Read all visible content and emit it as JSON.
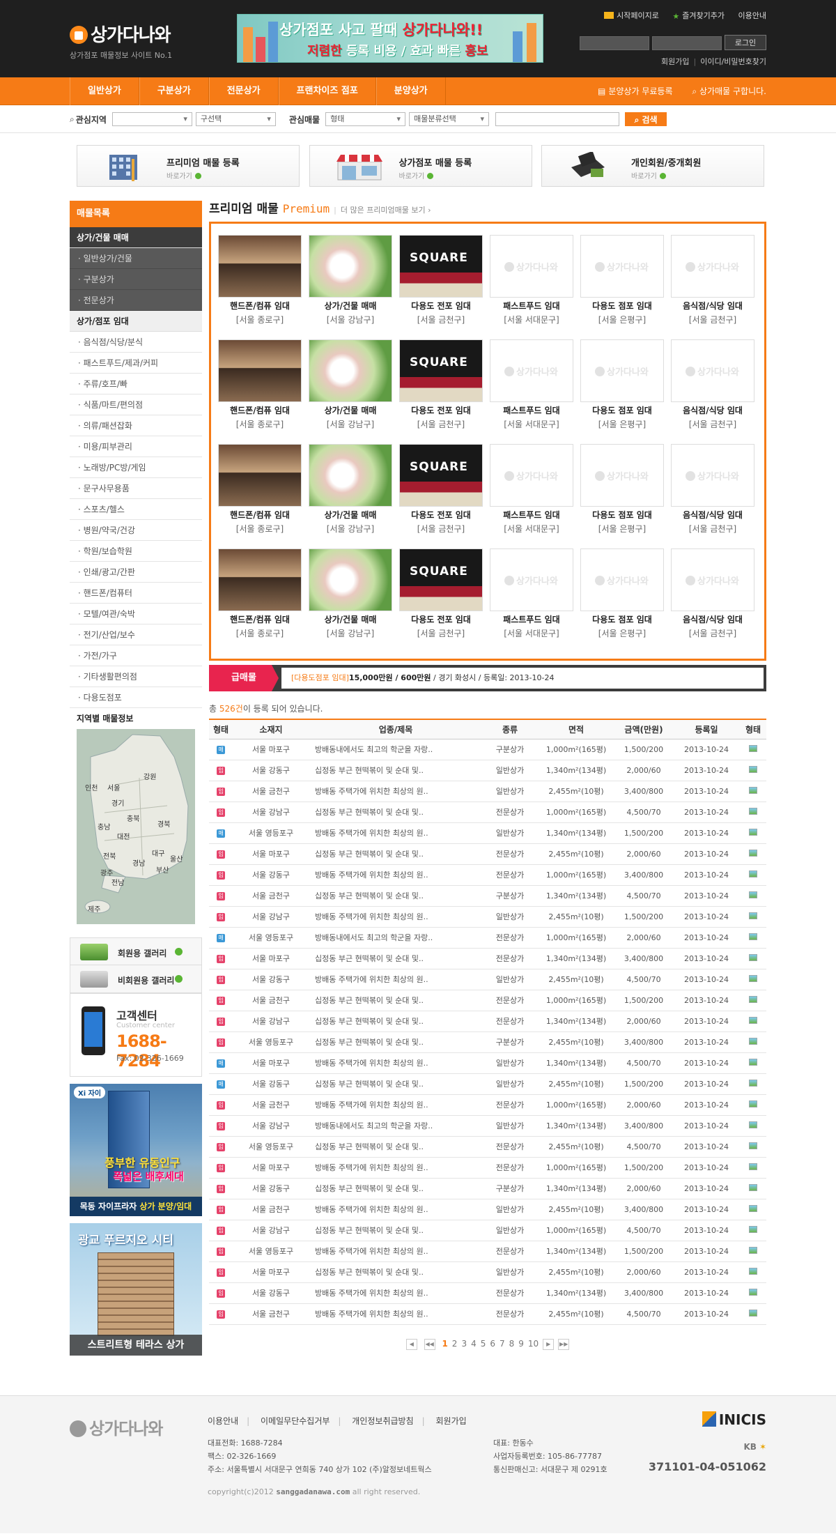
{
  "header": {
    "logo_text": "상가다나와",
    "logo_sub": "상가점포 매물정보 사이트 No.1",
    "banner_line1_a": "상가점포 사고 팔때 ",
    "banner_line1_b": "상가다나와!!",
    "banner_line2_a": "저렴한",
    "banner_line2_b": " 등록 비용 / 효과 빠른 ",
    "banner_line2_c": "홍보",
    "top_links": [
      "시작페이지로",
      "즐겨찾기추가",
      "이용안내"
    ],
    "login_button": "로그인",
    "join": "회원가입",
    "find_id": "이이디/비밀번호찾기"
  },
  "nav": {
    "menu": [
      "일반상가",
      "구분상가",
      "전문상가",
      "프랜차이즈 점포",
      "분양상가"
    ],
    "free_register": "분양상가 무료등록",
    "looking": "상가매물 구합니다."
  },
  "search": {
    "region_label": "관심지역",
    "district_select": "구선택",
    "property_label": "관심매물",
    "type_select": "형태",
    "category_select": "매물분류선택",
    "button": "검색"
  },
  "quick": [
    {
      "title": "프리미엄 매물 등록",
      "sub": "바로가기"
    },
    {
      "title": "상가점포 매물 등록",
      "sub": "바로가기"
    },
    {
      "title": "개인회원/중개회원",
      "sub": "바로가기"
    }
  ],
  "sidebar": {
    "head": "매물목록",
    "sec1": "상가/건물 매매",
    "sec1_items": [
      "· 일반상가/건물",
      "· 구분상가",
      "· 전문상가"
    ],
    "sec2": "상가/점포 임대",
    "sec2_items": [
      "· 음식점/식당/분식",
      "· 패스트푸드/제과/커피",
      "· 주류/호프/빠",
      "· 식품/마트/편의점",
      "· 의류/패션잡화",
      "· 미용/피부관리",
      "· 노래방/PC방/게임",
      "· 문구사무용품",
      "· 스포츠/헬스",
      "· 병원/약국/건강",
      "· 학원/보습학원",
      "· 인쇄/광고/간판",
      "· 핸드폰/컴퓨터",
      "· 모텔/여관/숙박",
      "· 전기/산업/보수",
      "· 가전/가구",
      "· 기타생활편의점",
      "· 다용도점포"
    ],
    "map_title": "지역별 매물정보",
    "regions": [
      "강원",
      "인천",
      "서울",
      "경기",
      "충북",
      "충남",
      "대전",
      "경북",
      "전북",
      "대구",
      "울산",
      "경남",
      "부산",
      "광주",
      "전남",
      "제주"
    ],
    "gallery1": "회원용 갤러리",
    "gallery2": "비회원용 갤러리",
    "cs_title": "고객센터",
    "cs_en": "Customer center",
    "cs_phone": "1688-7284",
    "cs_fax": "Fax: 02-326-1669",
    "ad1_badge": "Xi 자이",
    "ad1_l1": "풍부한 유동인구",
    "ad1_l2": "폭넓은 배후세대",
    "ad1_bar_a": "목동 자이프라자 ",
    "ad1_bar_b": "상가 분양/임대",
    "ad2_title": "광교 푸르지오 시티",
    "ad2_bar": "스트리트형 테라스 상가"
  },
  "premium": {
    "title": "프리미엄 매물 ",
    "title_en": "Premium",
    "more": "더 많은 프리미엄매물 보기 ›",
    "img_square": "SQUARE",
    "placeholder": "상가다나와",
    "items": [
      {
        "name": "핸드폰/컴퓨 임대",
        "loc": "[서울 종로구]",
        "img": "r1"
      },
      {
        "name": "상가/건물 매매",
        "loc": "[서울 강남구]",
        "img": "r2"
      },
      {
        "name": "다용도 전포 임대",
        "loc": "[서울 금천구]",
        "img": "r3"
      },
      {
        "name": "패스트푸드 임대",
        "loc": "[서울 서대문구]",
        "img": "ph"
      },
      {
        "name": "다용도 점포 임대",
        "loc": "[서울 은평구]",
        "img": "ph"
      },
      {
        "name": "음식점/식당 임대",
        "loc": "[서울 금천구]",
        "img": "ph"
      }
    ]
  },
  "urgent": {
    "label": "급매물",
    "cat": "[다용도점포 임대]",
    "price": "15,000만원 / 600만원",
    "rest": " / 경기 화성시 / 등록일: 2013-10-24"
  },
  "list": {
    "total_a": "총 ",
    "total_b": "526건",
    "total_c": "이 등록 되어 있습니다.",
    "headers": [
      "형태",
      "소재지",
      "업종/제목",
      "종류",
      "면적",
      "금액(만원)",
      "등록일",
      "형태"
    ],
    "rows": [
      {
        "t": "m",
        "loc": "서울 마포구",
        "title": "방배동내에서도 최고의 학군을 자랑..",
        "kind": "구분상가",
        "area": "1,000m²(165평)",
        "price": "1,500/200",
        "date": "2013-10-24"
      },
      {
        "t": "i",
        "loc": "서울 강동구",
        "title": "십정동 부근 현떡볶이 및 순대 및..",
        "kind": "일반상가",
        "area": "1,340m²(134평)",
        "price": "2,000/60",
        "date": "2013-10-24"
      },
      {
        "t": "i",
        "loc": "서울 금천구",
        "title": "방배동 주택가에 위치한 최상의 원..",
        "kind": "일반상가",
        "area": "2,455m²(10평)",
        "price": "3,400/800",
        "date": "2013-10-24"
      },
      {
        "t": "i",
        "loc": "서울 강남구",
        "title": "십정동 부근 현떡볶이 및 순대 및..",
        "kind": "전문상가",
        "area": "1,000m²(165평)",
        "price": "4,500/70",
        "date": "2013-10-24"
      },
      {
        "t": "m",
        "loc": "서울 영등포구",
        "title": "방배동 주택가에 위치한 최상의 원..",
        "kind": "일반상가",
        "area": "1,340m²(134평)",
        "price": "1,500/200",
        "date": "2013-10-24"
      },
      {
        "t": "i",
        "loc": "서울 마포구",
        "title": "십정동 부근 현떡볶이 및 순대 및..",
        "kind": "전문상가",
        "area": "2,455m²(10평)",
        "price": "2,000/60",
        "date": "2013-10-24"
      },
      {
        "t": "i",
        "loc": "서울 강동구",
        "title": "방배동 주택가에 위치한 최상의 원..",
        "kind": "전문상가",
        "area": "1,000m²(165평)",
        "price": "3,400/800",
        "date": "2013-10-24"
      },
      {
        "t": "i",
        "loc": "서울 금천구",
        "title": "십정동 부근 현떡볶이 및 순대 및..",
        "kind": "구분상가",
        "area": "1,340m²(134평)",
        "price": "4,500/70",
        "date": "2013-10-24"
      },
      {
        "t": "i",
        "loc": "서울 강남구",
        "title": "방배동 주택가에 위치한 최상의 원..",
        "kind": "일반상가",
        "area": "2,455m²(10평)",
        "price": "1,500/200",
        "date": "2013-10-24"
      },
      {
        "t": "m",
        "loc": "서울 영등포구",
        "title": "방배동내에서도 최고의 학군을 자랑..",
        "kind": "전문상가",
        "area": "1,000m²(165평)",
        "price": "2,000/60",
        "date": "2013-10-24"
      },
      {
        "t": "i",
        "loc": "서울 마포구",
        "title": "십정동 부근 현떡볶이 및 순대 및..",
        "kind": "전문상가",
        "area": "1,340m²(134평)",
        "price": "3,400/800",
        "date": "2013-10-24"
      },
      {
        "t": "i",
        "loc": "서울 강동구",
        "title": "방배동 주택가에 위치한 최상의 원..",
        "kind": "일반상가",
        "area": "2,455m²(10평)",
        "price": "4,500/70",
        "date": "2013-10-24"
      },
      {
        "t": "i",
        "loc": "서울 금천구",
        "title": "십정동 부근 현떡볶이 및 순대 및..",
        "kind": "전문상가",
        "area": "1,000m²(165평)",
        "price": "1,500/200",
        "date": "2013-10-24"
      },
      {
        "t": "i",
        "loc": "서울 강남구",
        "title": "십정동 부근 현떡볶이 및 순대 및..",
        "kind": "전문상가",
        "area": "1,340m²(134평)",
        "price": "2,000/60",
        "date": "2013-10-24"
      },
      {
        "t": "i",
        "loc": "서울 영등포구",
        "title": "십정동 부근 현떡볶이 및 순대 및..",
        "kind": "구분상가",
        "area": "2,455m²(10평)",
        "price": "3,400/800",
        "date": "2013-10-24"
      },
      {
        "t": "m",
        "loc": "서울 마포구",
        "title": "방배동 주택가에 위치한 최상의 원..",
        "kind": "일반상가",
        "area": "1,340m²(134평)",
        "price": "4,500/70",
        "date": "2013-10-24"
      },
      {
        "t": "m",
        "loc": "서울 강동구",
        "title": "십정동 부근 현떡볶이 및 순대 및..",
        "kind": "일반상가",
        "area": "2,455m²(10평)",
        "price": "1,500/200",
        "date": "2013-10-24"
      },
      {
        "t": "i",
        "loc": "서울 금천구",
        "title": "방배동 주택가에 위치한 최상의 원..",
        "kind": "전문상가",
        "area": "1,000m²(165평)",
        "price": "2,000/60",
        "date": "2013-10-24"
      },
      {
        "t": "i",
        "loc": "서울 강남구",
        "title": "방배동내에서도 최고의 학군을 자랑..",
        "kind": "일반상가",
        "area": "1,340m²(134평)",
        "price": "3,400/800",
        "date": "2013-10-24"
      },
      {
        "t": "i",
        "loc": "서울 영등포구",
        "title": "십정동 부근 현떡볶이 및 순대 및..",
        "kind": "전문상가",
        "area": "2,455m²(10평)",
        "price": "4,500/70",
        "date": "2013-10-24"
      },
      {
        "t": "i",
        "loc": "서울 마포구",
        "title": "방배동 주택가에 위치한 최상의 원..",
        "kind": "전문상가",
        "area": "1,000m²(165평)",
        "price": "1,500/200",
        "date": "2013-10-24"
      },
      {
        "t": "i",
        "loc": "서울 강동구",
        "title": "십정동 부근 현떡볶이 및 순대 및..",
        "kind": "구분상가",
        "area": "1,340m²(134평)",
        "price": "2,000/60",
        "date": "2013-10-24"
      },
      {
        "t": "i",
        "loc": "서울 금천구",
        "title": "방배동 주택가에 위치한 최상의 원..",
        "kind": "일반상가",
        "area": "2,455m²(10평)",
        "price": "3,400/800",
        "date": "2013-10-24"
      },
      {
        "t": "i",
        "loc": "서울 강남구",
        "title": "십정동 부근 현떡볶이 및 순대 및..",
        "kind": "일반상가",
        "area": "1,000m²(165평)",
        "price": "4,500/70",
        "date": "2013-10-24"
      },
      {
        "t": "i",
        "loc": "서울 영등포구",
        "title": "방배동 주택가에 위치한 최상의 원..",
        "kind": "전문상가",
        "area": "1,340m²(134평)",
        "price": "1,500/200",
        "date": "2013-10-24"
      },
      {
        "t": "i",
        "loc": "서울 마포구",
        "title": "십정동 부근 현떡볶이 및 순대 및..",
        "kind": "일반상가",
        "area": "2,455m²(10평)",
        "price": "2,000/60",
        "date": "2013-10-24"
      },
      {
        "t": "i",
        "loc": "서울 강동구",
        "title": "방배동 주택가에 위치한 최상의 원..",
        "kind": "전문상가",
        "area": "1,340m²(134평)",
        "price": "3,400/800",
        "date": "2013-10-24"
      },
      {
        "t": "i",
        "loc": "서울 금천구",
        "title": "방배동 주택가에 위치한 최상의 원..",
        "kind": "전문상가",
        "area": "2,455m²(10평)",
        "price": "4,500/70",
        "date": "2013-10-24"
      }
    ],
    "type_glyphs": {
      "m": "매",
      "i": "임"
    },
    "pages": [
      "1",
      "2",
      "3",
      "4",
      "5",
      "6",
      "7",
      "8",
      "9",
      "10"
    ]
  },
  "footer": {
    "links": [
      "이용안내",
      "이메일무단수집거부",
      "개인정보취급방침",
      "회원가입"
    ],
    "info_left": [
      "대표전화: 1688-7284",
      "팩스: 02-326-1669",
      "주소: 서울특별시 서대문구 연희동 740 상가 102 (주)알정보네트웍스"
    ],
    "info_right": [
      "대표: 한동수",
      "사업자등록번호: 105-86-77787",
      "통신판매신고: 서대문구 제 0291호"
    ],
    "copy_a": "copyright(c)2012 ",
    "copy_b": "sanggadanawa.com",
    "copy_c": " all right reserved.",
    "inicis": "INICIS",
    "kb": "KB",
    "kb_num": "371101-04-051062"
  }
}
